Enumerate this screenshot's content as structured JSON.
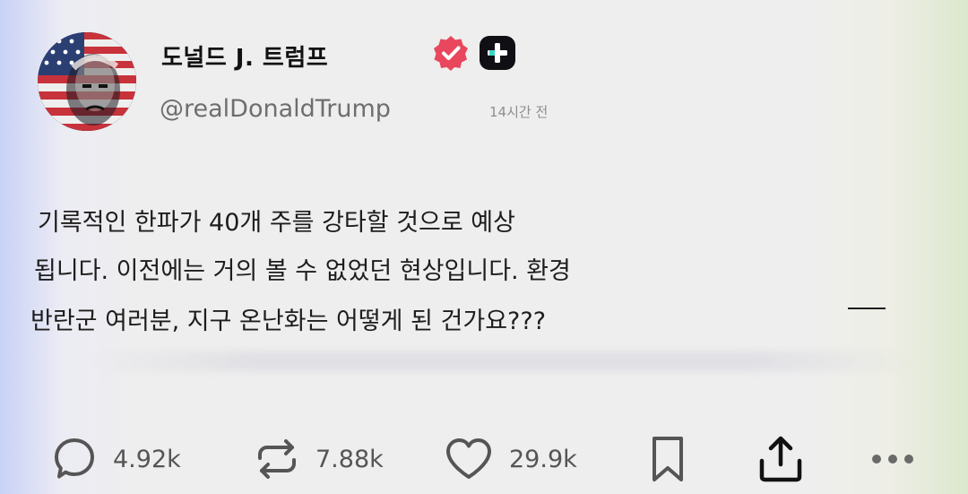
{
  "profile": {
    "display_name": "도널드 J. 트럼프",
    "handle": "@realDonaldTrump",
    "timestamp": "14시간 전",
    "verified_icon": "verified-check-badge",
    "app_icon": "plus-app-badge",
    "colors": {
      "verified": "#e8475d",
      "app_badge": "#101014"
    }
  },
  "post": {
    "lines": [
      "기록적인 한파가 40개 주를 강타할 것으로 예상",
      "됩니다. 이전에는 거의 볼 수 없었던 현상입니다. 환경",
      "반란군 여러분, 지구 온난화는 어떻게 된 건가요???"
    ]
  },
  "actions": {
    "reply": {
      "icon": "speech-bubble-icon",
      "count": "4.92k"
    },
    "repost": {
      "icon": "repost-arrows-icon",
      "count": "7.88k"
    },
    "like": {
      "icon": "heart-icon",
      "count": "29.9k"
    },
    "bookmark": {
      "icon": "bookmark-icon"
    },
    "share": {
      "icon": "share-upload-icon"
    },
    "more": {
      "icon": "more-dots-icon"
    }
  }
}
